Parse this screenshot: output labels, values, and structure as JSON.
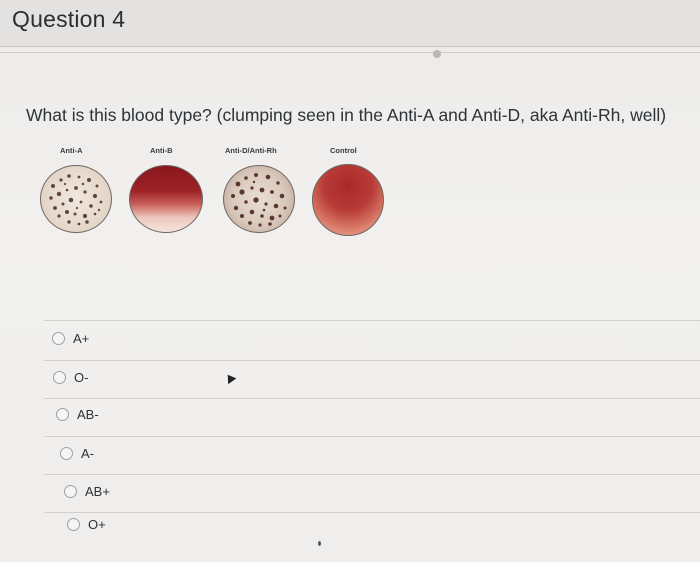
{
  "question": {
    "title": "Question 4",
    "prompt": "What is this blood type? (clumping seen in the Anti-A and Anti-D, aka Anti-Rh, well)"
  },
  "figure": {
    "wells": [
      {
        "label": "Anti-A",
        "state": "clumped"
      },
      {
        "label": "Anti-B",
        "state": "smooth"
      },
      {
        "label": "Anti-D/Anti-Rh",
        "state": "clumped"
      },
      {
        "label": "Control",
        "state": "smooth"
      }
    ],
    "colors": {
      "blood_dark": "#8e1a1f",
      "blood_light": "#f2d2c6",
      "clump_bg": "#e9ddd2",
      "clump_dark": "#5a2a22"
    }
  },
  "answers": {
    "options": [
      {
        "label": "A+"
      },
      {
        "label": "O-"
      },
      {
        "label": "AB-"
      },
      {
        "label": "A-"
      },
      {
        "label": "AB+"
      },
      {
        "label": "O+"
      }
    ]
  }
}
